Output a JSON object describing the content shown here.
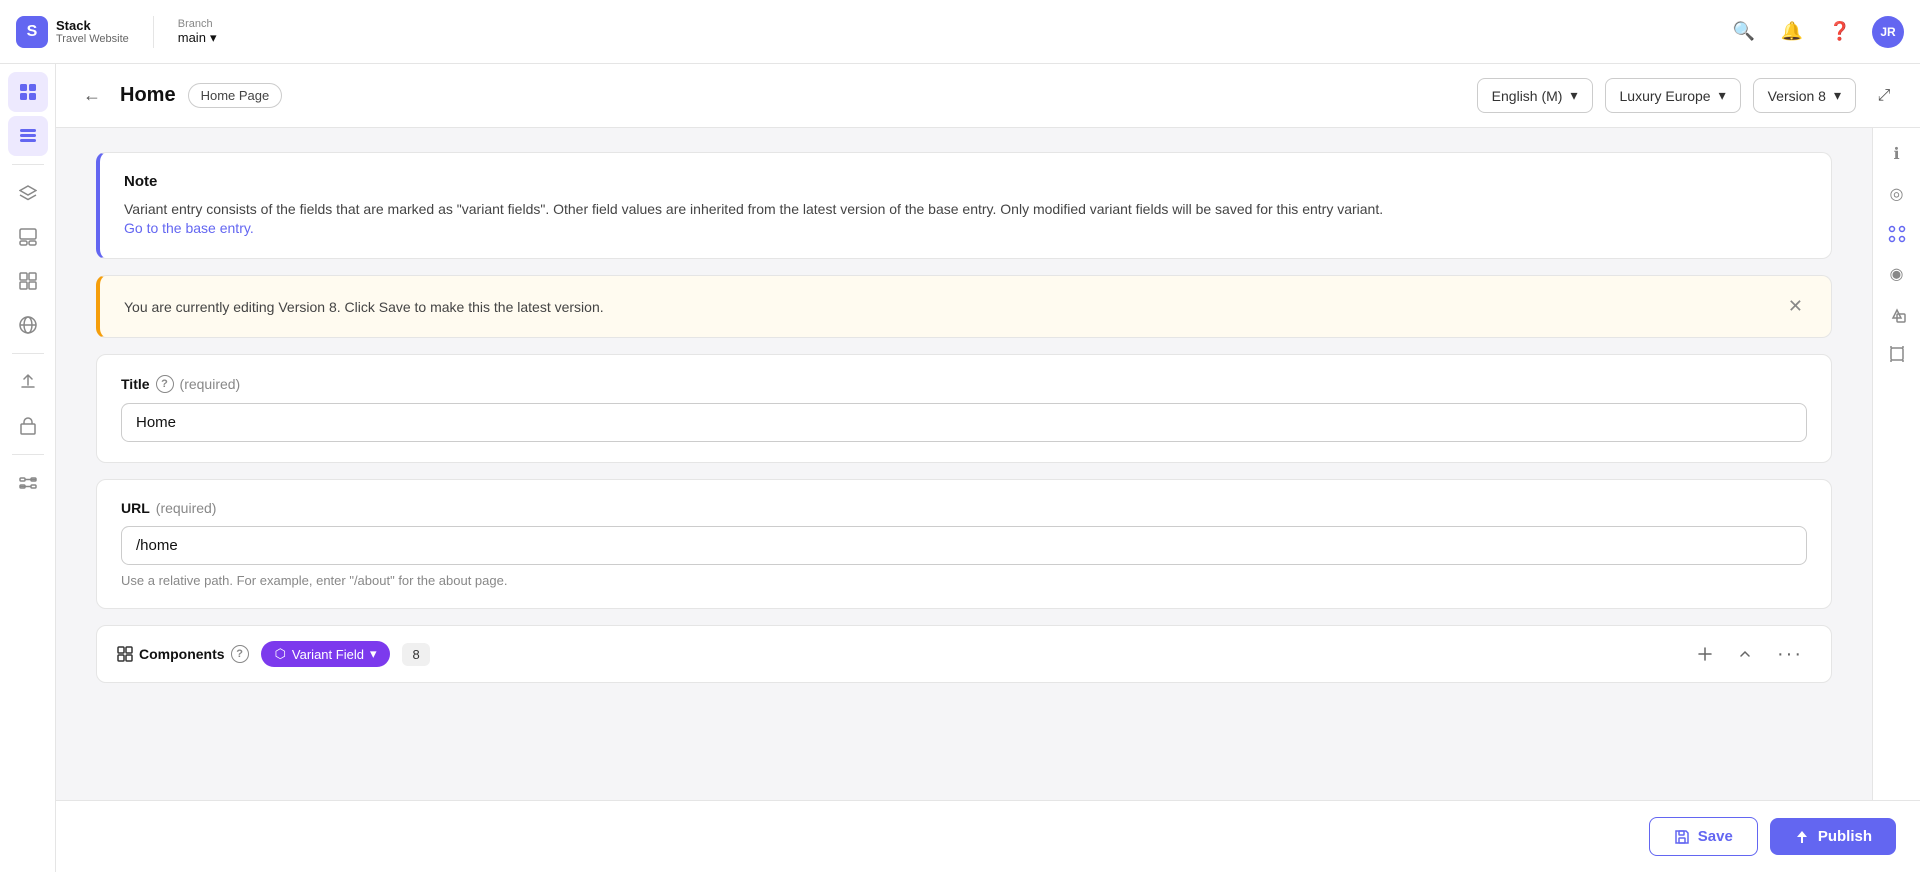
{
  "topNav": {
    "logoText": "S",
    "brandTitle": "Stack",
    "brandSub": "Travel Website",
    "branchLabel": "Branch",
    "branchValue": "main",
    "userInitials": "JR"
  },
  "contentHeader": {
    "pageTitle": "Home",
    "pageTag": "Home Page",
    "selector1Label": "English (M)",
    "selector2Label": "Luxury Europe",
    "selector3Label": "Version 8"
  },
  "noteBox": {
    "title": "Note",
    "body": "Variant entry consists of the fields that are marked as \"variant fields\". Other field values are inherited from the latest version of the base entry. Only modified variant fields will be saved for this entry variant.",
    "linkText": "Go to the base entry."
  },
  "warningBox": {
    "text": "You are currently editing Version 8. Click Save to make this the latest version."
  },
  "titleField": {
    "label": "Title",
    "required": "(required)",
    "value": "Home"
  },
  "urlField": {
    "label": "URL",
    "required": "(required)",
    "value": "/home",
    "hint": "Use a relative path. For example, enter \"/about\" for the about page."
  },
  "componentsBar": {
    "label": "Components",
    "variantBadgeText": "Variant Field",
    "count": "8"
  },
  "buttons": {
    "save": "Save",
    "publish": "Publish"
  },
  "sidebar": {
    "items": [
      {
        "icon": "⊞",
        "name": "dashboard-icon"
      },
      {
        "icon": "☰",
        "name": "list-icon"
      },
      {
        "icon": "⧉",
        "name": "layers-icon"
      },
      {
        "icon": "▭",
        "name": "layout-icon"
      },
      {
        "icon": "⊞",
        "name": "grid-icon"
      },
      {
        "icon": "⊕",
        "name": "globe-icon"
      },
      {
        "icon": "◉",
        "name": "radio-icon"
      },
      {
        "icon": "↑",
        "name": "upload-icon"
      },
      {
        "icon": "☖",
        "name": "store-icon"
      },
      {
        "icon": "⊞",
        "name": "widget-icon"
      }
    ]
  },
  "rightPanel": {
    "items": [
      {
        "icon": "ℹ",
        "name": "info-icon"
      },
      {
        "icon": "◎",
        "name": "target-icon"
      },
      {
        "icon": "⇄",
        "name": "transform-icon"
      },
      {
        "icon": "◉",
        "name": "radio2-icon"
      },
      {
        "icon": "△○",
        "name": "shapes-icon"
      },
      {
        "icon": "⊡",
        "name": "frame-icon"
      }
    ]
  }
}
